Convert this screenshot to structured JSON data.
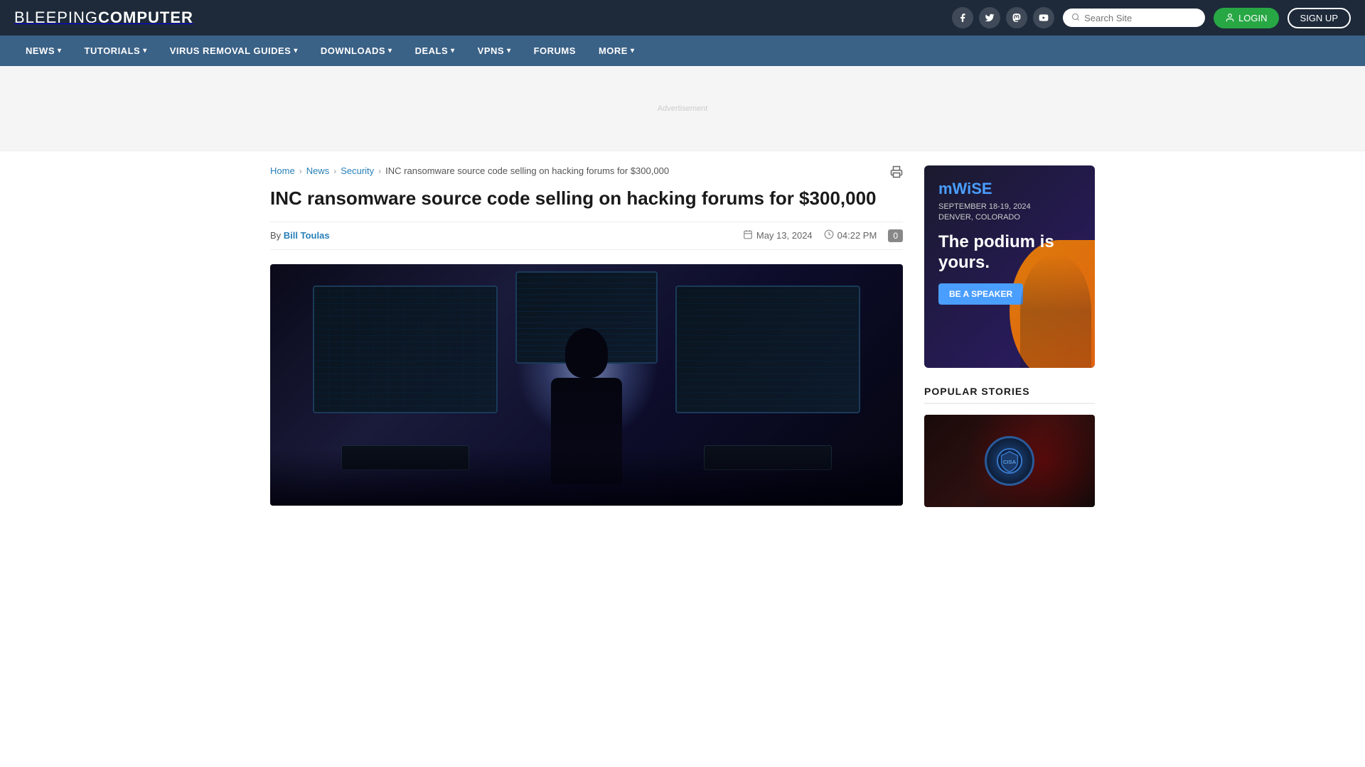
{
  "site": {
    "name_light": "BLEEPING",
    "name_bold": "COMPUTER"
  },
  "header": {
    "search_placeholder": "Search Site",
    "login_label": "LOGIN",
    "signup_label": "SIGN UP",
    "social": [
      {
        "name": "facebook",
        "icon": "f"
      },
      {
        "name": "twitter",
        "icon": "t"
      },
      {
        "name": "mastodon",
        "icon": "m"
      },
      {
        "name": "youtube",
        "icon": "▶"
      }
    ]
  },
  "nav": {
    "items": [
      {
        "label": "NEWS",
        "has_dropdown": true
      },
      {
        "label": "TUTORIALS",
        "has_dropdown": true
      },
      {
        "label": "VIRUS REMOVAL GUIDES",
        "has_dropdown": true
      },
      {
        "label": "DOWNLOADS",
        "has_dropdown": true
      },
      {
        "label": "DEALS",
        "has_dropdown": true
      },
      {
        "label": "VPNS",
        "has_dropdown": true
      },
      {
        "label": "FORUMS",
        "has_dropdown": false
      },
      {
        "label": "MORE",
        "has_dropdown": true
      }
    ]
  },
  "breadcrumb": {
    "items": [
      {
        "label": "Home",
        "href": "#"
      },
      {
        "label": "News",
        "href": "#"
      },
      {
        "label": "Security",
        "href": "#"
      },
      {
        "label": "INC ransomware source code selling on hacking forums for $300,000",
        "is_current": true
      }
    ]
  },
  "article": {
    "title": "INC ransomware source code selling on hacking forums for $300,000",
    "author": "Bill Toulas",
    "date": "May 13, 2024",
    "time": "04:22 PM",
    "comment_count": "0"
  },
  "sidebar": {
    "ad": {
      "logo_light": "mW",
      "logo_accent": "iSE",
      "subtitle_line1": "SEPTEMBER 18-19, 2024",
      "subtitle_line2": "DENVER, COLORADO",
      "tagline": "The podium is yours.",
      "button_label": "BE A SPEAKER"
    },
    "popular_stories": {
      "title": "POPULAR STORIES"
    }
  }
}
